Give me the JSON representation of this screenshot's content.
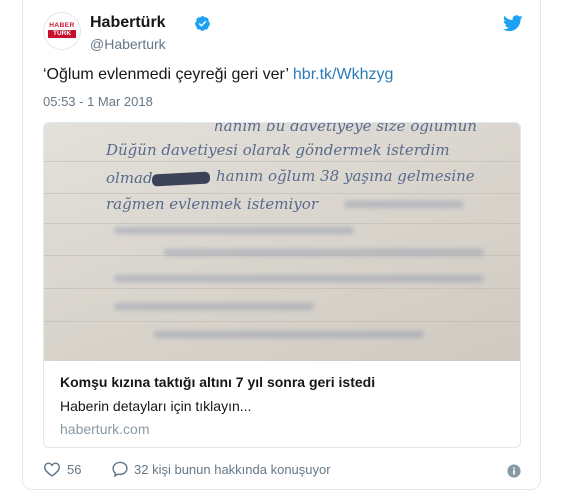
{
  "tweet": {
    "avatar_top": "HABER",
    "avatar_bottom": "TÜRK",
    "name": "Habertürk",
    "handle": "@Haberturk",
    "text": "‘Oğlum evlenmedi çeyreği geri ver’",
    "link": "hbr.tk/Wkhzyg",
    "timestamp": "05:53 - 1 Mar 2018",
    "brand_color": "#1da1f2",
    "link_color": "#2b7bb9"
  },
  "card": {
    "image_handwriting": [
      "hanım bu davetiyeye size oğlumun",
      "Düğün davetiyesi olarak göndermek isterdim",
      "olmadı",
      "hanım oğlum 38 yaşına gelmesine",
      "rağmen evlenmek istemiyor"
    ],
    "title": "Komşu kızına taktığı altını 7 yıl sonra geri istedi",
    "description": "Haberin detayları için tıklayın...",
    "domain": "haberturk.com"
  },
  "actions": {
    "likes": "56",
    "replies_text": "32 kişi bunun hakkında konuşuyor"
  },
  "icons": {
    "verified": "verified-badge-icon",
    "twitter": "twitter-bird-icon",
    "like": "heart-icon",
    "reply": "speech-bubble-icon",
    "info": "info-icon"
  }
}
